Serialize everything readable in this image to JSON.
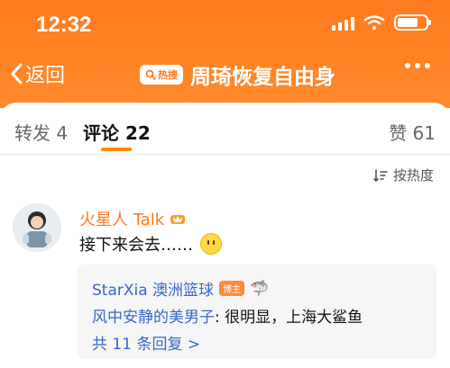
{
  "status_bar": {
    "time": "12:32",
    "icons": [
      "signal-icon",
      "wifi-icon",
      "battery-icon"
    ]
  },
  "header": {
    "back_label": "返回",
    "hot_badge": "热搜",
    "title": "周琦恢复自由身",
    "colors": {
      "orange": "#ff7a1f"
    }
  },
  "tabs": [
    {
      "label": "转发 4"
    },
    {
      "label": "评论 22"
    },
    {
      "label": "赞 61"
    }
  ],
  "sort": {
    "label": "按热度"
  },
  "comment": {
    "author": "火星人 Talk",
    "text": "接下来会去……",
    "emoji": "smile-icon",
    "replies": {
      "first_author": "StarXia 澳洲篮球",
      "blogger_badge": "博主",
      "first_text": "🦈",
      "second_author": "风中安静的美男子",
      "second_text": ": 很明显，上海大鲨鱼",
      "more": "共 11 条回复 >"
    }
  }
}
